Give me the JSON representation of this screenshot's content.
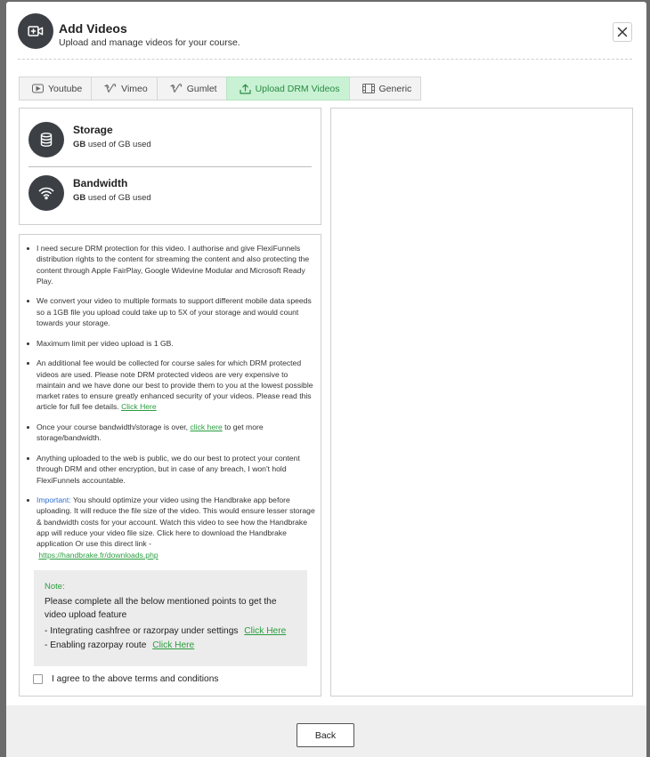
{
  "header": {
    "title": "Add Videos",
    "subtitle": "Upload and manage videos for your course.",
    "icon": "video-plus-icon"
  },
  "tabs": [
    {
      "label": "Youtube",
      "icon": "youtube-icon",
      "active": false
    },
    {
      "label": "Vimeo",
      "icon": "vimeo-icon",
      "active": false
    },
    {
      "label": "Gumlet",
      "icon": "gumlet-icon",
      "active": false
    },
    {
      "label": "Upload DRM Videos",
      "icon": "upload-icon",
      "active": true
    },
    {
      "label": "Generic",
      "icon": "film-icon",
      "active": false
    }
  ],
  "stats": {
    "storage": {
      "name": "Storage",
      "unit": "GB",
      "usage_text": "used of GB used",
      "icon": "database-icon"
    },
    "bandwidth": {
      "name": "Bandwidth",
      "unit": "GB",
      "usage_text": "used of GB used",
      "icon": "wifi-icon"
    }
  },
  "terms": {
    "item1": "I need secure DRM protection for this video. I authorise and give FlexiFunnels distribution rights to the content for streaming the content and also protecting the content through Apple FairPlay, Google Widevine Modular and Microsoft Ready Play.",
    "item2": "We convert your video to multiple formats to support different mobile data speeds so a 1GB file you upload could take up to 5X of your storage and would count towards your storage.",
    "item3": "Maximum limit per video upload is 1 GB.",
    "item4": "An additional fee would be collected for course sales for which DRM protected videos are used. Please note DRM protected videos are very expensive to maintain and we have done our best to provide them to you at the lowest possible market rates to ensure greatly enhanced security of your videos. Please read this article for full fee details.",
    "item4_link": "Click Here",
    "item5_before": "Once your course bandwidth/storage is over,",
    "item5_link": "click here",
    "item5_after": "to get more storage/bandwidth.",
    "item6": "Anything uploaded to the web is public, we do our best to protect your content through DRM and other encryption, but in case of any breach, I won't hold FlexiFunnels accountable.",
    "item7_label": "Important:",
    "item7": "You should optimize your video using the Handbrake app before uploading. It will reduce the file size of the video. This would ensure lesser storage & bandwidth costs for your account. Watch this video to see how the Handbrake app will reduce your video file size. Click here to download the Handbrake application Or use this direct link -",
    "item7_link": "https://handbrake.fr/downloads.php"
  },
  "note": {
    "title": "Note:",
    "text": "Please complete all the below mentioned points to get the video upload feature",
    "line1": "- Integrating cashfree or razorpay under settings",
    "line1_link": "Click Here",
    "line2": "- Enabling razorpay route",
    "line2_link": "Click Here"
  },
  "agree_label": "I agree to the above terms and conditions",
  "footer": {
    "back_label": "Back"
  },
  "colors": {
    "accent": "#2a9d3f",
    "active_tab_bg": "#c8f2d3",
    "icon_bg": "#3c3f44",
    "important": "#2e6fd1"
  }
}
